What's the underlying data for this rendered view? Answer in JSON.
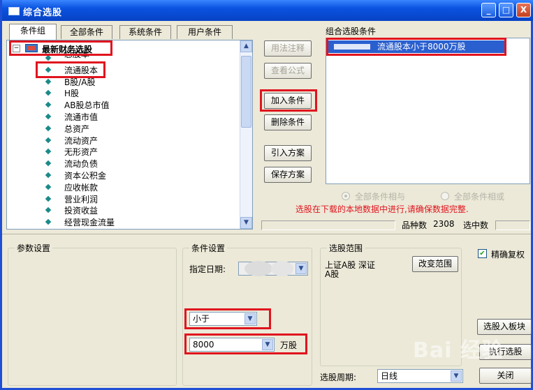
{
  "window": {
    "title": "综合选股",
    "controls": {
      "minimize": "_",
      "maximize": "□",
      "close": "X"
    }
  },
  "tabs": [
    "条件组",
    "全部条件",
    "系统条件",
    "用户条件"
  ],
  "tree": {
    "root": "最新财务选股",
    "items": [
      "总股本",
      "流通股本",
      "B股/A股",
      "H股",
      "AB股总市值",
      "流通市值",
      "总资产",
      "流动资产",
      "无形资产",
      "流动负债",
      "资本公积金",
      "应收帐款",
      "营业利润",
      "投资收益",
      "经营现金流量"
    ]
  },
  "buttons": {
    "usage_notes": "用法注释",
    "view_formula": "查看公式",
    "add_condition": "加入条件",
    "delete_condition": "删除条件",
    "import_scheme": "引入方案",
    "save_scheme": "保存方案",
    "change_range": "改变范围",
    "stock_to_block": "选股入板块",
    "execute": "执行选股",
    "close": "关闭"
  },
  "combo_conditions": {
    "label": "组合选股条件",
    "items": [
      "流通股本小于8000万股"
    ]
  },
  "logic": {
    "all_hold": "全部条件相与",
    "any_hold": "全部条件相或",
    "selected": "all_hold"
  },
  "warning": "选股在下载的本地数据中进行,请确保数据完整.",
  "stats": {
    "count_label": "品种数",
    "count_value": "2308",
    "selected_label": "选中数"
  },
  "params": {
    "label": "参数设置"
  },
  "condition_setting": {
    "label": "条件设置",
    "date_label": "指定日期:",
    "operator": "小于",
    "value": "8000",
    "unit": "万股"
  },
  "range": {
    "label": "选股范围",
    "text_line1": "上证A股 深证",
    "text_line2": "A股"
  },
  "precise_reweight": {
    "label": "精确复权",
    "checked": true
  },
  "period": {
    "label": "选股周期:",
    "value": "日线"
  },
  "watermark": "Bai 经验",
  "colors": {
    "title_bar": "#0a52e0",
    "highlight_red": "#e0141e",
    "warning_text": "#e0141e",
    "selection_blue": "#2a5fcf"
  }
}
